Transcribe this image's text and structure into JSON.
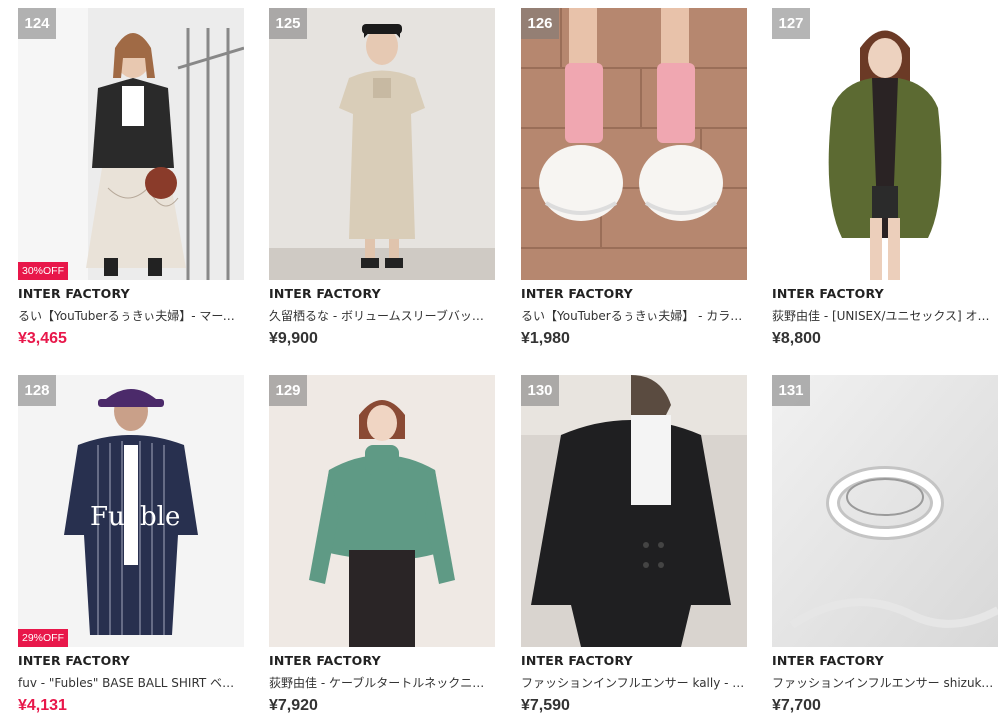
{
  "products": [
    {
      "rank": "124",
      "badge": "30%OFF",
      "brand": "INTER FACTORY",
      "name": "るい【YouTuberるぅきぃ夫婦】- マーブル柄",
      "price": "¥3,465"
    },
    {
      "rank": "125",
      "badge": "",
      "brand": "INTER FACTORY",
      "name": "久留栖るな - ボリュームスリーブバックリボン",
      "price": "¥9,900"
    },
    {
      "rank": "126",
      "badge": "",
      "brand": "INTER FACTORY",
      "name": "るい【YouTuberるぅきぃ夫婦】 - カラーソックス",
      "price": "¥1,980"
    },
    {
      "rank": "127",
      "badge": "",
      "brand": "INTER FACTORY",
      "name": "荻野由佳 - [UNISEX/ユニセックス] オーバーサイズ",
      "price": "¥8,800"
    },
    {
      "rank": "128",
      "badge": "29%OFF",
      "brand": "INTER FACTORY",
      "name": "fuv - \"Fubles\" BASE BALL SHIRT ベースボール",
      "price": "¥4,131"
    },
    {
      "rank": "129",
      "badge": "",
      "brand": "INTER FACTORY",
      "name": "荻野由佳 - ケーブルタートルネックニット",
      "price": "¥7,920"
    },
    {
      "rank": "130",
      "badge": "",
      "brand": "INTER FACTORY",
      "name": "ファッションインフルエンサー kally - ジャケット",
      "price": "¥7,590"
    },
    {
      "rank": "131",
      "badge": "",
      "brand": "INTER FACTORY",
      "name": "ファッションインフルエンサー shizuka リング",
      "price": "¥7,700"
    }
  ]
}
